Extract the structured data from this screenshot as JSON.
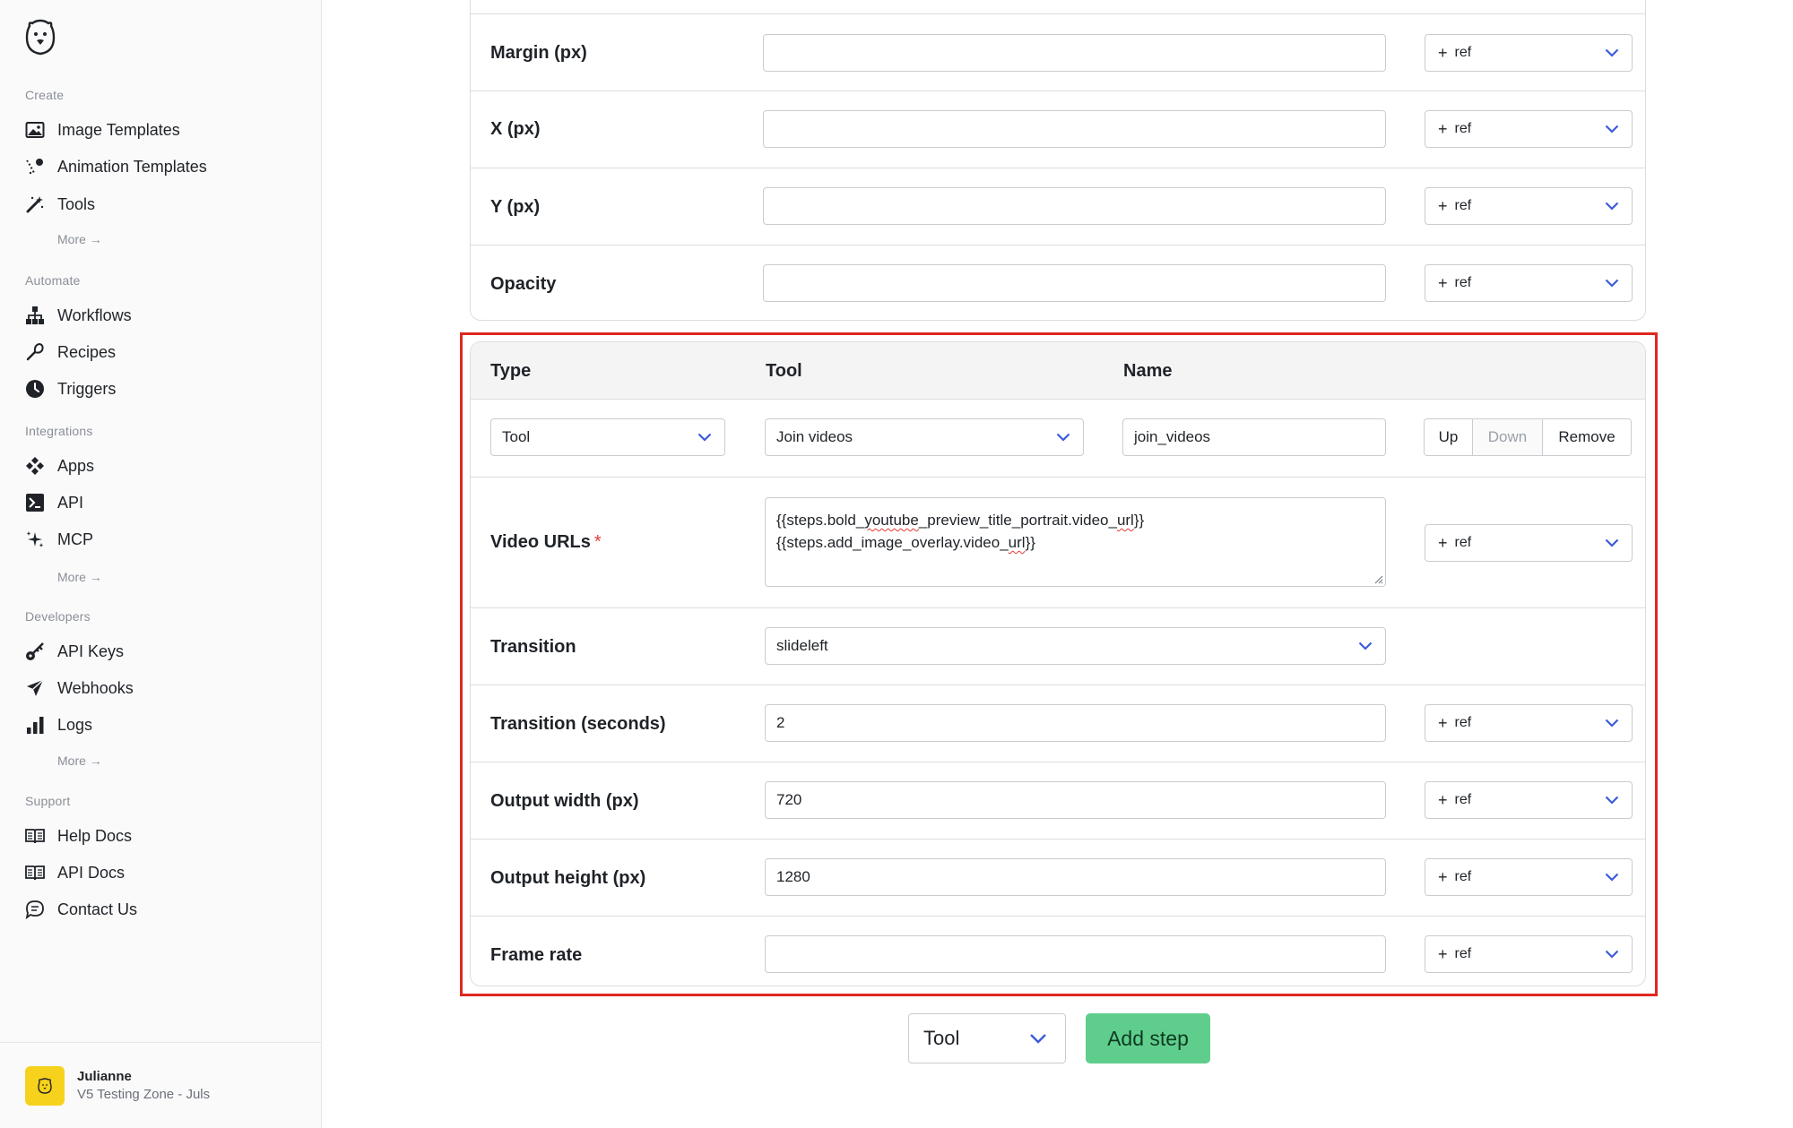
{
  "sidebar": {
    "sections": [
      {
        "label": "Create",
        "items": [
          {
            "label": "Image Templates",
            "icon": "image-icon"
          },
          {
            "label": "Animation Templates",
            "icon": "animation-icon"
          },
          {
            "label": "Tools",
            "icon": "magic-wand-icon"
          }
        ],
        "more": "More →"
      },
      {
        "label": "Automate",
        "items": [
          {
            "label": "Workflows",
            "icon": "workflow-icon"
          },
          {
            "label": "Recipes",
            "icon": "recipe-icon"
          },
          {
            "label": "Triggers",
            "icon": "clock-icon"
          }
        ]
      },
      {
        "label": "Integrations",
        "items": [
          {
            "label": "Apps",
            "icon": "apps-icon"
          },
          {
            "label": "API",
            "icon": "terminal-icon"
          },
          {
            "label": "MCP",
            "icon": "sparkle-icon"
          }
        ],
        "more": "More →"
      },
      {
        "label": "Developers",
        "items": [
          {
            "label": "API Keys",
            "icon": "key-icon"
          },
          {
            "label": "Webhooks",
            "icon": "send-icon"
          },
          {
            "label": "Logs",
            "icon": "bar-chart-icon"
          }
        ],
        "more": "More →"
      },
      {
        "label": "Support",
        "items": [
          {
            "label": "Help Docs",
            "icon": "book-icon"
          },
          {
            "label": "API Docs",
            "icon": "book-icon"
          },
          {
            "label": "Contact Us",
            "icon": "chat-icon"
          }
        ]
      }
    ],
    "user": {
      "name": "Julianne",
      "org": "V5 Testing Zone - Juls"
    }
  },
  "top_card": {
    "rows": [
      {
        "label": "Margin (px)",
        "value": "",
        "ref": "ref"
      },
      {
        "label": "X (px)",
        "value": "",
        "ref": "ref"
      },
      {
        "label": "Y (px)",
        "value": "",
        "ref": "ref"
      },
      {
        "label": "Opacity",
        "value": "",
        "ref": "ref"
      }
    ]
  },
  "step": {
    "headers": {
      "type": "Type",
      "tool": "Tool",
      "name": "Name"
    },
    "type_value": "Tool",
    "tool_value": "Join videos",
    "name_value": "join_videos",
    "buttons": {
      "up": "Up",
      "down": "Down",
      "remove": "Remove"
    },
    "video_urls": {
      "label": "Video URLs",
      "required_mark": "*",
      "line1_pre": "{{steps.bold_",
      "line1_sq1": "youtube",
      "line1_mid": "_preview_title_portrait.video_",
      "line1_sq2": "url",
      "line1_post": "}}",
      "line2_pre": "{{steps.add_image_overlay.video_",
      "line2_sq": "url",
      "line2_post": "}}",
      "ref": "ref"
    },
    "transition": {
      "label": "Transition",
      "value": "slideleft"
    },
    "transition_seconds": {
      "label": "Transition (seconds)",
      "value": "2",
      "ref": "ref"
    },
    "output_width": {
      "label": "Output width (px)",
      "value": "720",
      "ref": "ref"
    },
    "output_height": {
      "label": "Output height (px)",
      "value": "1280",
      "ref": "ref"
    },
    "frame_rate": {
      "label": "Frame rate",
      "value": "",
      "ref": "ref"
    }
  },
  "footer": {
    "type_value": "Tool",
    "add_label": "Add step"
  },
  "colors": {
    "accent": "#3b5bdb",
    "highlight": "#e0281f",
    "add_button": "#5fce8d"
  }
}
